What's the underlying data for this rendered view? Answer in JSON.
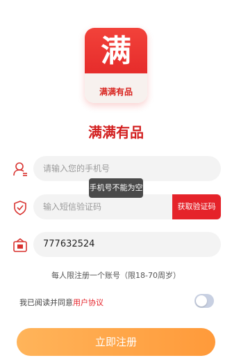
{
  "logo": {
    "char": "满",
    "subtitle": "满满有品"
  },
  "app_name": "满满有品",
  "phone": {
    "placeholder": "请输入您的手机号"
  },
  "sms_code": {
    "placeholder": "输入短信验证码",
    "button_label": "获取验证码"
  },
  "toast": "手机号不能为空",
  "id_field": {
    "value": "777632524"
  },
  "hint": "每人限注册一个账号（限18-70周岁）",
  "agreement": {
    "prefix": "我已阅读并同意",
    "link": "用户协议",
    "toggled": false
  },
  "submit_label": "立即注册",
  "colors": {
    "accent": "#e5232a",
    "submit": "#ff9f40"
  },
  "icons": [
    "user-icon",
    "shield-check-icon",
    "id-card-icon"
  ]
}
